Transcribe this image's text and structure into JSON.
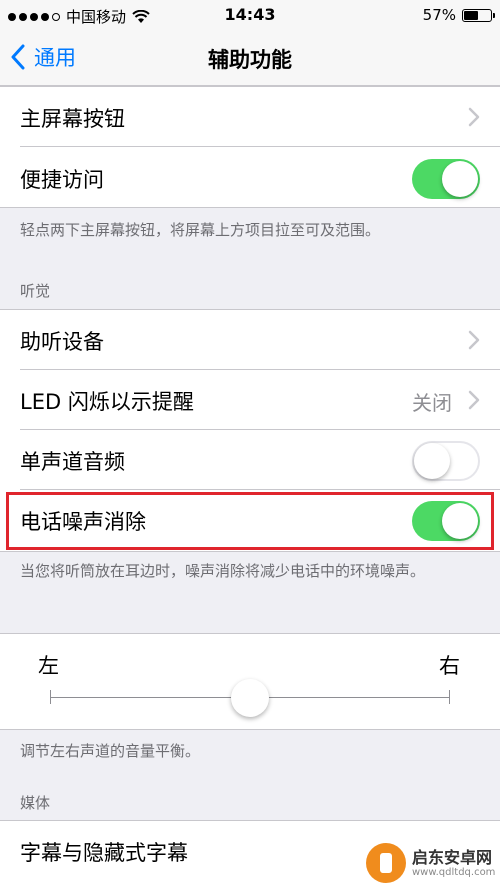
{
  "status": {
    "carrier": "中国移动",
    "time": "14:43",
    "battery": "57%",
    "battery_level": 0.57
  },
  "nav": {
    "back_label": "通用",
    "title": "辅助功能"
  },
  "rows": {
    "home_button": "主屏幕按钮",
    "reachability": "便捷访问",
    "reachability_on": true,
    "reachability_footer": "轻点两下主屏幕按钮，将屏幕上方项目拉至可及范围。",
    "hearing_header": "听觉",
    "hearing_devices": "助听设备",
    "led_flash": "LED 闪烁以示提醒",
    "led_flash_value": "关闭",
    "mono_audio": "单声道音频",
    "mono_audio_on": false,
    "phone_noise": "电话噪声消除",
    "phone_noise_on": true,
    "phone_noise_footer": "当您将听筒放在耳边时，噪声消除将减少电话中的环境噪声。",
    "balance_left": "左",
    "balance_right": "右",
    "balance_value": 0.5,
    "balance_footer": "调节左右声道的音量平衡。",
    "media_header": "媒体",
    "subtitles": "字幕与隐藏式字幕"
  },
  "watermark": {
    "name": "启东安卓网",
    "url": "www.qdltdq.com"
  }
}
